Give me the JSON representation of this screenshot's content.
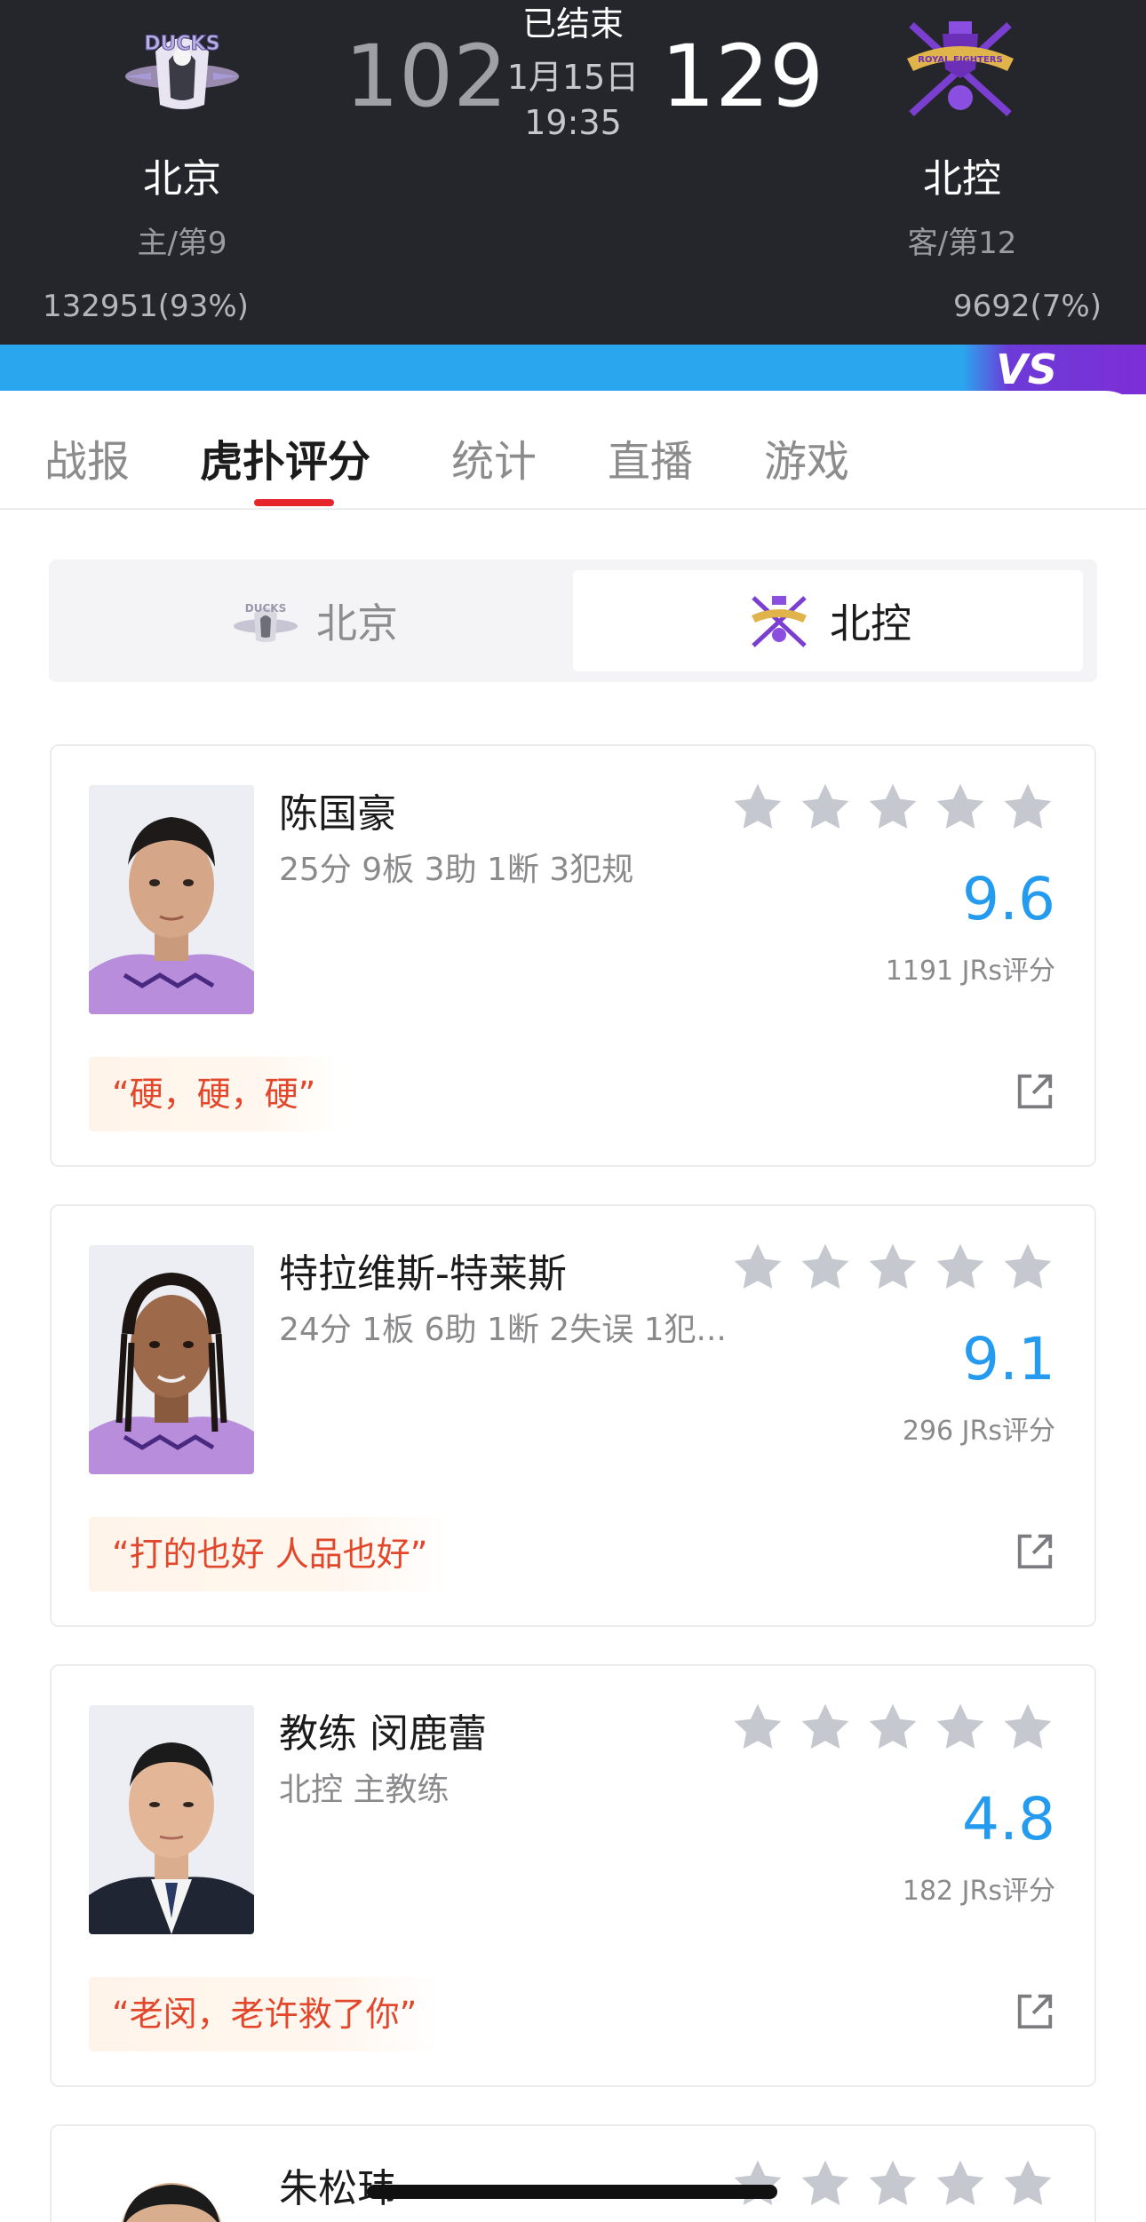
{
  "match": {
    "status": "已结束",
    "date": "1月15日",
    "time": "19:35",
    "home": {
      "name": "北京",
      "rank": "主/第9",
      "score": "102",
      "support": "132951(93%)",
      "logo_text": "DUCKS"
    },
    "away": {
      "name": "北控",
      "rank": "客/第12",
      "score": "129",
      "support": "9692(7%)",
      "logo_text": "ROYAL FIGHTERS"
    }
  },
  "vs_label": "VS",
  "tabs": [
    {
      "label": "战报"
    },
    {
      "label": "虎扑评分"
    },
    {
      "label": "统计"
    },
    {
      "label": "直播"
    },
    {
      "label": "游戏"
    }
  ],
  "team_switch": {
    "left": "北京",
    "right": "北控",
    "selected": "北控"
  },
  "players": [
    {
      "name": "陈国豪",
      "stats": "25分 9板 3助 1断 3犯规",
      "rating": "9.6",
      "votes": "1191 JRs评分",
      "quote": "“硬，硬，硬”"
    },
    {
      "name": "特拉维斯-特莱斯",
      "stats": "24分 1板 6助 1断 2失误 1犯...",
      "rating": "9.1",
      "votes": "296 JRs评分",
      "quote": "“打的也好 人品也好”"
    },
    {
      "name": "教练 闵鹿蕾",
      "stats": "北控 主教练",
      "rating": "4.8",
      "votes": "182 JRs评分",
      "quote": "“老闵，老许救了你”"
    },
    {
      "name": "朱松玮"
    }
  ],
  "colors": {
    "header_bg": "#25262b",
    "accent_blue": "#259bf0",
    "tab_underline": "#e5252b",
    "quote_text": "#e2472b",
    "star_grey": "#c6c8cf"
  },
  "icons": {
    "star": "star-icon",
    "share": "external-link-icon"
  }
}
